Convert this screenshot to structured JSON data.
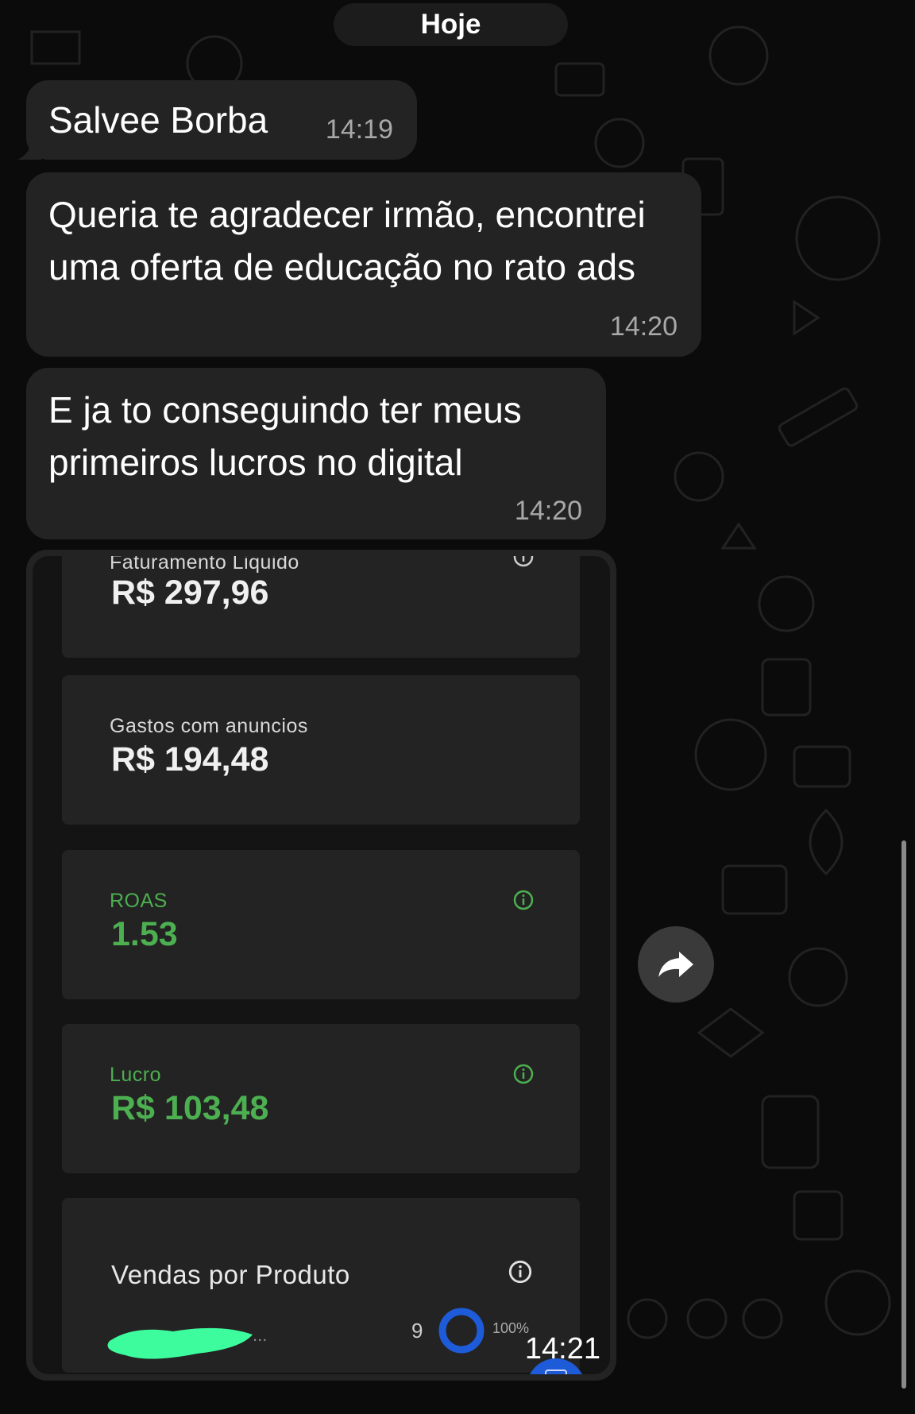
{
  "chat": {
    "date_label": "Hoje",
    "messages": [
      {
        "text": "Salvee Borba",
        "time": "14:19"
      },
      {
        "text": "Queria te agradecer irmão, encontrei uma oferta de educação no rato ads",
        "time": "14:20"
      },
      {
        "text": "E ja to conseguindo ter meus primeiros lucros no digital",
        "time": "14:20"
      }
    ],
    "image_message": {
      "time": "14:21",
      "screenshot": {
        "cards": [
          {
            "label": "Faturamento Liquido",
            "value": "R$ 297,96"
          },
          {
            "label": "Gastos com anuncios",
            "value": "R$ 194,48"
          },
          {
            "label": "ROAS",
            "value": "1.53"
          },
          {
            "label": "Lucro",
            "value": "R$ 103,48"
          }
        ],
        "sales_card": {
          "title": "Vendas por Produto",
          "product_suffix": "...",
          "count": "9",
          "percent": "100%"
        }
      }
    }
  },
  "colors": {
    "background": "#0b0b0b",
    "bubble": "#232323",
    "accent_green": "#4caf50",
    "ring_blue": "#1e5bd8"
  },
  "icons": {
    "forward": "forward-arrow-icon",
    "info": "info-circle-icon"
  }
}
